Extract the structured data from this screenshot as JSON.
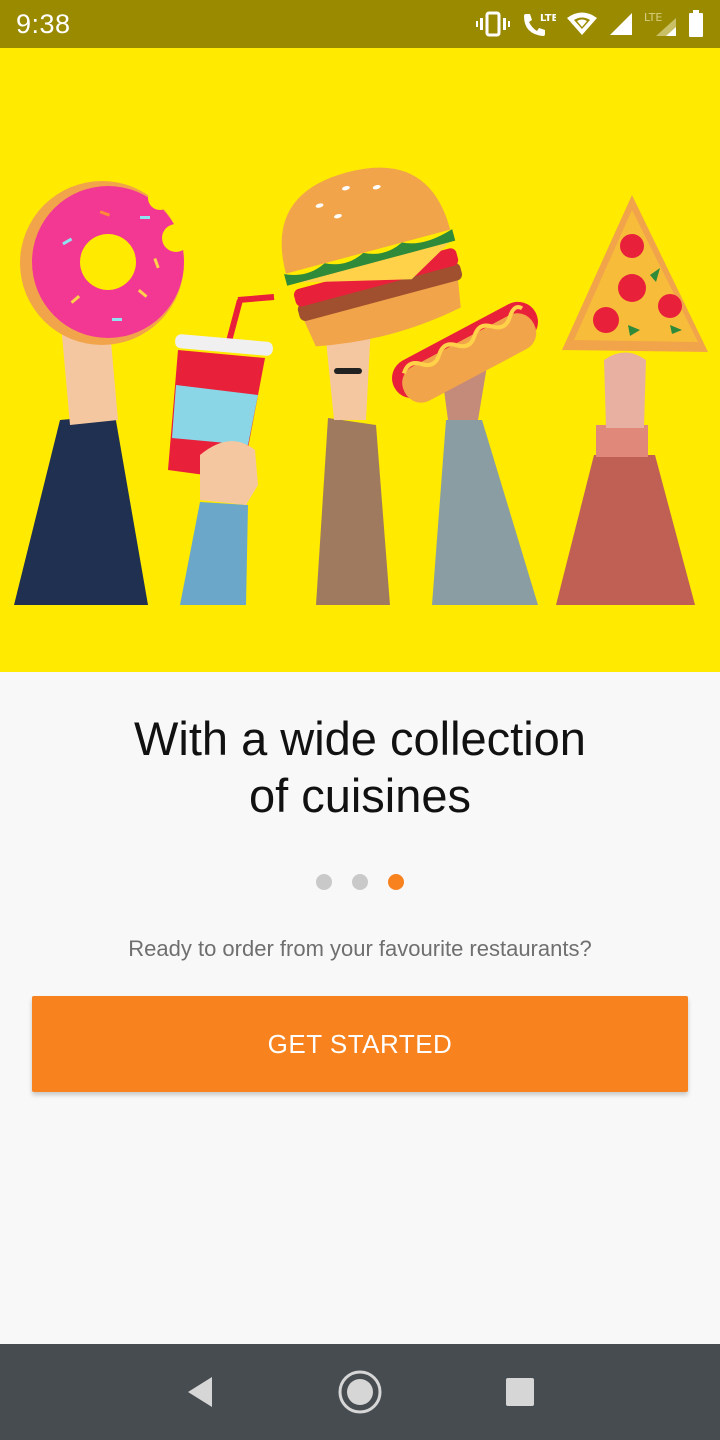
{
  "status_bar": {
    "time": "9:38",
    "icons": [
      "vibrate-icon",
      "lte-call-icon",
      "wifi-icon",
      "signal-icon",
      "lte-signal-icon",
      "battery-icon"
    ]
  },
  "hero": {
    "illustration": "hands-holding-food-illustration",
    "background_color": "#ffea00"
  },
  "onboarding": {
    "headline_line1": "With a wide collection",
    "headline_line2": "of cuisines",
    "page_count": 3,
    "active_page": 3,
    "subtitle": "Ready to order from your favourite restaurants?",
    "cta_label": "GET STARTED",
    "accent_color": "#f7821e"
  },
  "nav_bar": {
    "buttons": [
      "back-icon",
      "home-icon",
      "recents-icon"
    ]
  }
}
